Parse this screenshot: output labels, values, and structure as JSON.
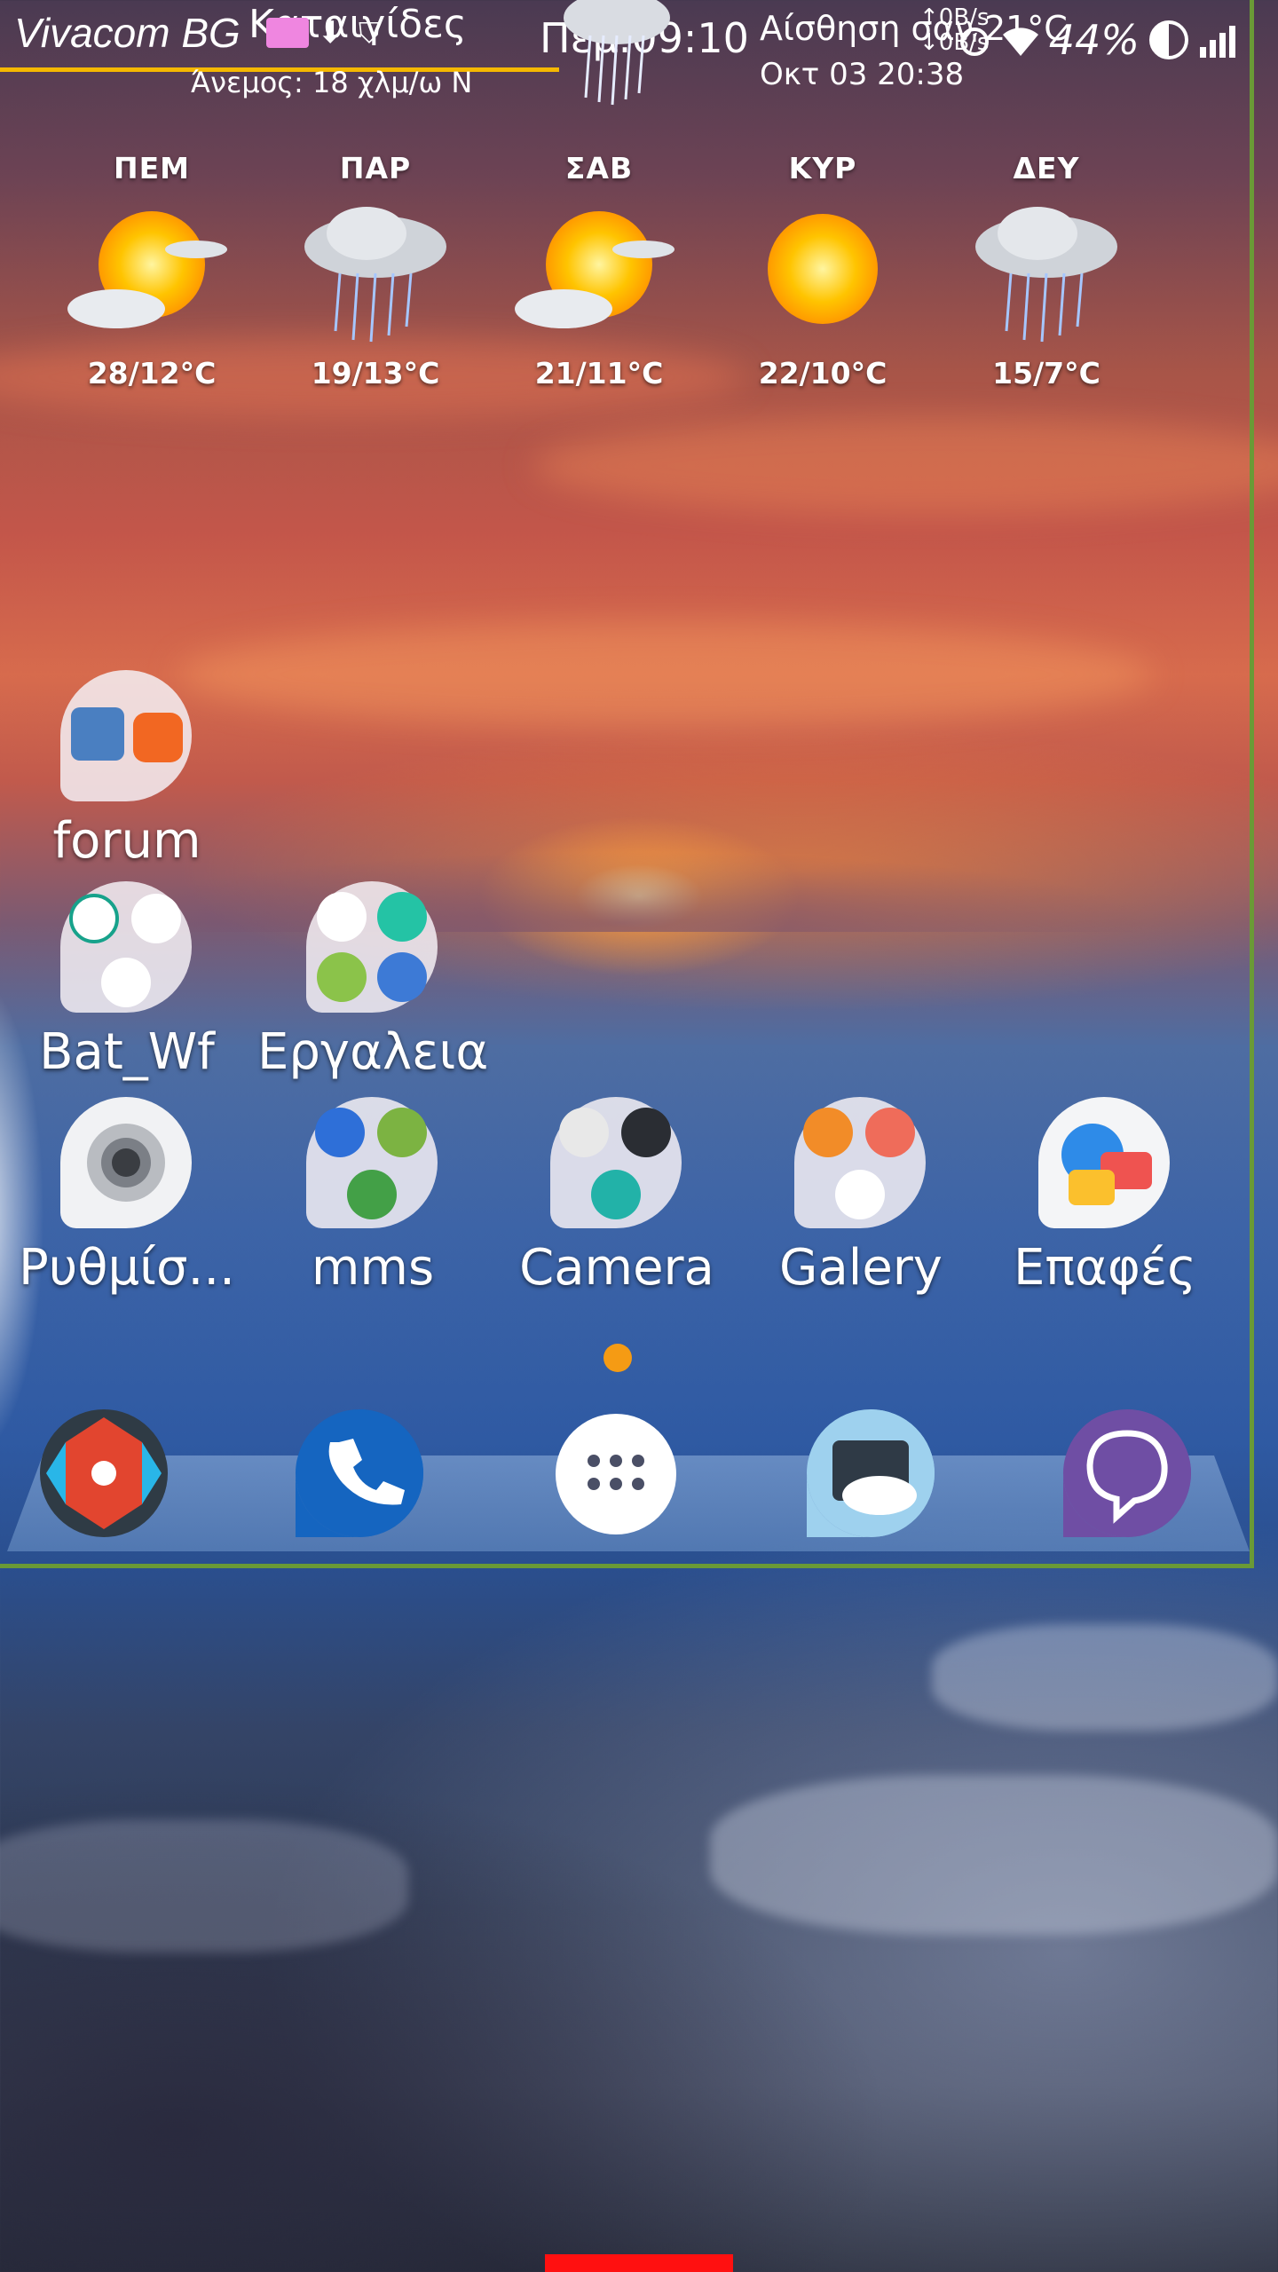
{
  "status_bar": {
    "carrier": "Vivacom BG",
    "weather_status": "Καταιγίδες",
    "wind": "Άνεμος: 18 χλμ/ω N",
    "time": "Πεμ.09:10",
    "feels_like": "Αίσθηση σαν 21°C",
    "date": "Οκτ 03  20:38",
    "net_up": "↑0B/s",
    "net_down": "↓0B/s",
    "battery": "44%"
  },
  "forecast": [
    {
      "day": "ΠΕΜ",
      "temp": "28/12°C",
      "icon": "sun-cloud-icon"
    },
    {
      "day": "ΠΑΡ",
      "temp": "19/13°C",
      "icon": "rain-cloud-icon"
    },
    {
      "day": "ΣΑΒ",
      "temp": "21/11°C",
      "icon": "sun-cloud-icon"
    },
    {
      "day": "ΚΥΡ",
      "temp": "22/10°C",
      "icon": "sun-icon"
    },
    {
      "day": "ΔΕΥ",
      "temp": "15/7°C",
      "icon": "rain-cloud-icon"
    }
  ],
  "apps": {
    "forum": "forum",
    "bat_wf": "Bat_Wf",
    "tools": "Εργαλεια",
    "settings": "Ρυθμίσ...",
    "mms": "mms",
    "camera": "Camera",
    "gallery": "Galery",
    "contacts": "Επαφές"
  },
  "dock": [
    "nova-settings-icon",
    "phone-icon",
    "app-drawer-icon",
    "es-file-explorer-icon",
    "viber-icon"
  ],
  "colors": {
    "accent_orange": "#f59b14",
    "frame_green": "#6a9a36",
    "status_line": "#f5b800"
  }
}
